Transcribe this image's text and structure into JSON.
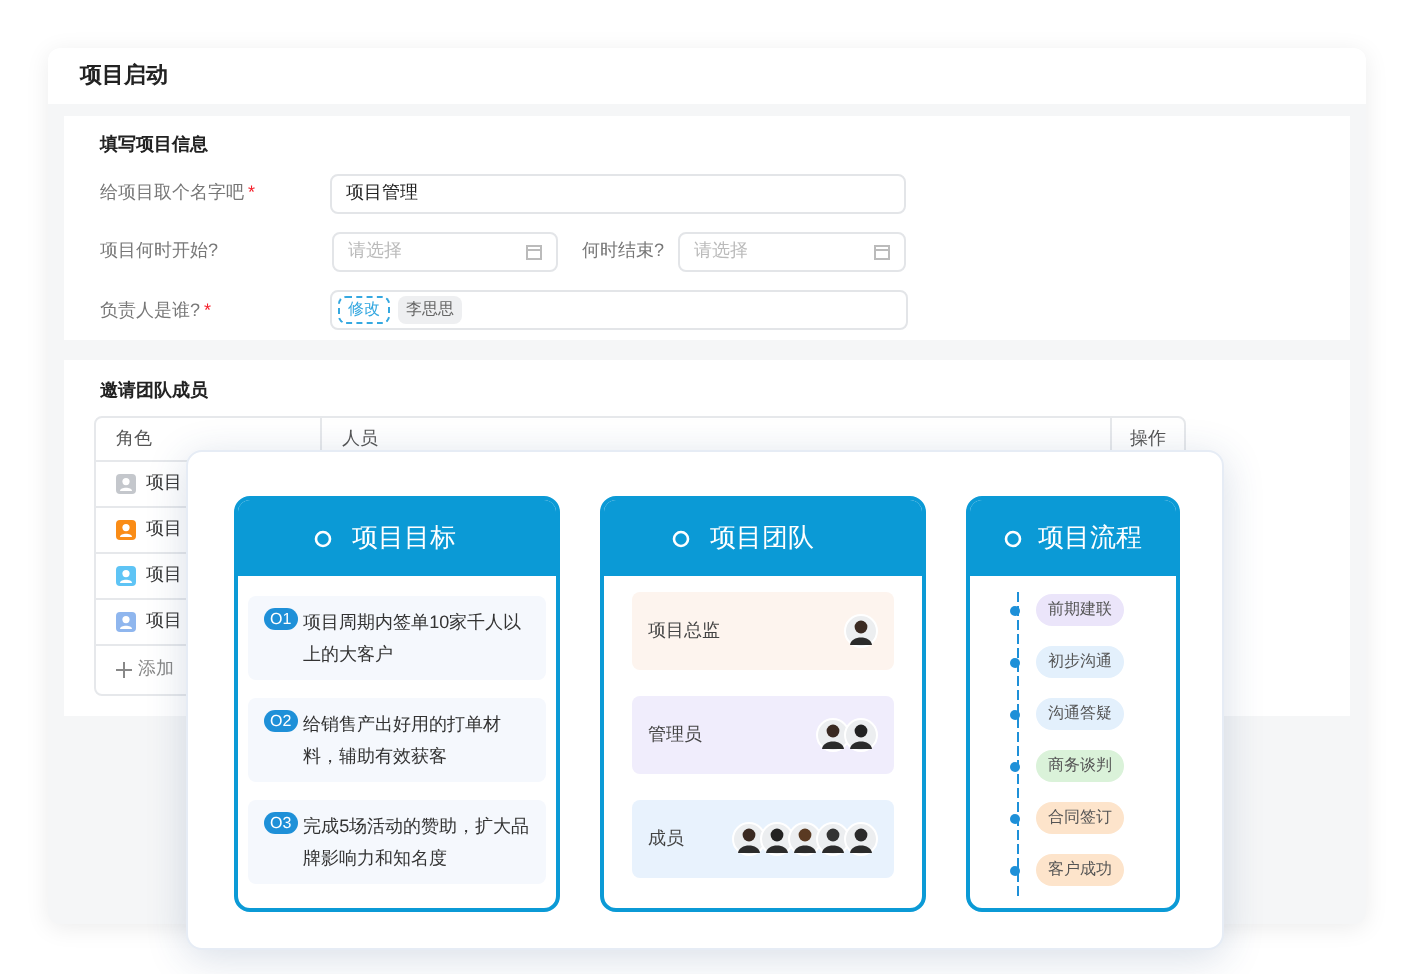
{
  "page": {
    "title": "项目启动"
  },
  "form": {
    "title": "填写项目信息",
    "name": {
      "label": "给项目取个名字吧",
      "required_mark": "*",
      "value": "项目管理"
    },
    "start": {
      "label": "项目何时开始?",
      "placeholder": "请选择"
    },
    "end": {
      "label": "何时结束?",
      "placeholder": "请选择"
    },
    "owner": {
      "label": "负责人是谁?",
      "required_mark": "*",
      "edit_tag": "修改",
      "person": "李思思"
    }
  },
  "team_table": {
    "title": "邀请团队成员",
    "columns": [
      "角色",
      "人员",
      "操作"
    ],
    "rows": [
      {
        "role": "项目",
        "color": "#c4c7cc"
      },
      {
        "role": "项目",
        "color": "#fa8c16"
      },
      {
        "role": "项目",
        "color": "#5ec4f5"
      },
      {
        "role": "项目",
        "color": "#8fb6ee"
      }
    ],
    "add_label": "添加"
  },
  "goals": {
    "title": "项目目标",
    "items": [
      {
        "badge": "O1",
        "text": "项目周期内签单10家千人以上的大客户"
      },
      {
        "badge": "O2",
        "text": "给销售产出好用的打单材料，辅助有效获客"
      },
      {
        "badge": "O3",
        "text": "完成5场活动的赞助，扩大品牌影响力和知名度"
      }
    ]
  },
  "team": {
    "title": "项目团队",
    "groups": [
      {
        "name": "项目总监",
        "color": "#fdf4ee",
        "avatars": [
          {
            "kind": "person"
          }
        ]
      },
      {
        "name": "管理员",
        "color": "#f0edfc",
        "avatars": [
          {
            "kind": "person"
          },
          {
            "kind": "person"
          }
        ]
      },
      {
        "name": "成员",
        "color": "#e8f2fd",
        "avatars": [
          {
            "kind": "person"
          },
          {
            "kind": "person"
          },
          {
            "kind": "person"
          },
          {
            "kind": "person"
          },
          {
            "kind": "person"
          }
        ]
      }
    ]
  },
  "flow": {
    "title": "项目流程",
    "steps": [
      {
        "label": "前期建联",
        "color": "#ebe5fa"
      },
      {
        "label": "初步沟通",
        "color": "#e3f0fc"
      },
      {
        "label": "沟通答疑",
        "color": "#e3f0fc"
      },
      {
        "label": "商务谈判",
        "color": "#daf2d9"
      },
      {
        "label": "合同签订",
        "color": "#fde4cb"
      },
      {
        "label": "客户成功",
        "color": "#fde4cb"
      }
    ]
  }
}
